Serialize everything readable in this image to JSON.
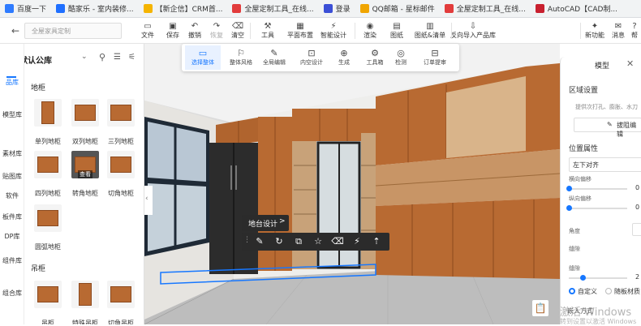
{
  "browser": {
    "bookmarks": [
      {
        "label": "百度一下",
        "color": "#2e7bff"
      },
      {
        "label": "酷家乐 - 室内装修...",
        "color": "#1f6fff"
      },
      {
        "label": "【新企信】CRM首...",
        "color": "#f5b400"
      },
      {
        "label": "全屋定制工具_在线...",
        "color": "#e23c3c"
      },
      {
        "label": "登录",
        "color": "#3b4fd6"
      },
      {
        "label": "QQ邮箱 - 星标邮件",
        "color": "#f0a500"
      },
      {
        "label": "全屋定制工具_在线...",
        "color": "#e23c3c"
      },
      {
        "label": "AutoCAD【CAD制...",
        "color": "#c8202f"
      }
    ]
  },
  "toolbar": {
    "project_name": "全屋家具定制",
    "buttons": [
      {
        "label": "文件",
        "icon": "folder-icon"
      },
      {
        "label": "保存",
        "icon": "save-icon"
      },
      {
        "label": "撤销",
        "icon": "undo-icon"
      },
      {
        "label": "恢复",
        "icon": "redo-icon"
      },
      {
        "label": "清空",
        "icon": "clear-icon"
      },
      {
        "label": "工具",
        "icon": "tool-icon"
      },
      {
        "label": "平面布置",
        "icon": "floorplan-icon"
      },
      {
        "label": "智能设计",
        "icon": "smart-design-icon"
      },
      {
        "label": "渲染",
        "icon": "render-icon"
      },
      {
        "label": "图纸",
        "icon": "drawing-icon"
      },
      {
        "label": "图纸&清单",
        "icon": "drawing-list-icon"
      },
      {
        "label": "反向导入产品库",
        "icon": "import-icon"
      },
      {
        "label": "新功能",
        "icon": "new-feature-icon"
      },
      {
        "label": "消息",
        "icon": "message-icon"
      },
      {
        "label": "帮",
        "icon": "help-icon"
      }
    ]
  },
  "left_rail": {
    "items": [
      "品库",
      "模型库",
      "素材库",
      "贴图库",
      "软件",
      "板件库",
      "DP库",
      "组件库",
      "组合库"
    ]
  },
  "library": {
    "title": "定制默认公库",
    "sections": [
      {
        "title": "地柜",
        "items": [
          "单列地柜",
          "双列地柜",
          "三列地柜",
          "四列地柜",
          "转角地柜",
          "切角地柜",
          "圆弧地柜"
        ]
      },
      {
        "title": "吊柜",
        "items": [
          "吊柜",
          "特殊吊柜",
          "切角吊柜"
        ]
      }
    ],
    "hover_label": "查看"
  },
  "float_toolbar": {
    "buttons": [
      {
        "label": "选择整体",
        "active": true
      },
      {
        "label": "整体风格",
        "active": false
      },
      {
        "label": "全局编辑",
        "active": false
      },
      {
        "label": "内空设计",
        "active": false
      },
      {
        "label": "生成",
        "active": false
      },
      {
        "label": "工具箱",
        "active": false
      },
      {
        "label": "检测",
        "active": false
      },
      {
        "label": "订单提审",
        "active": false
      }
    ]
  },
  "context": {
    "title": "地台设计",
    "arrow": ">",
    "icons": [
      "edit-icon",
      "rotate-icon",
      "copy-icon",
      "favorite-icon",
      "erase-icon",
      "flash-icon",
      "move-up-icon"
    ]
  },
  "right_panel": {
    "tab": "模型",
    "region_title": "区域设置",
    "region_hint": "提供次打孔、膨胀、水刀",
    "edit_button": "拔阻编辑",
    "position_title": "位置属性",
    "align_value": "左下对齐",
    "h_offset_label": "横向偏移",
    "h_offset_value": "0",
    "v_offset_label": "纵向偏移",
    "v_offset_value": "0",
    "angle_label": "角度",
    "gap_label": "缝隙",
    "gap2_label": "缝隙",
    "gap2_value": "2",
    "radio_custom": "自定义",
    "radio_follow": "随板材质",
    "bottom_label": "嵌入方式"
  },
  "watermark": {
    "line1": "激活 Windows",
    "line2": "转到设置以激活 Windows"
  },
  "colors": {
    "accent": "#1677ff",
    "wood": "#b86a32",
    "dark_cabinet": "#2c2c2c"
  }
}
